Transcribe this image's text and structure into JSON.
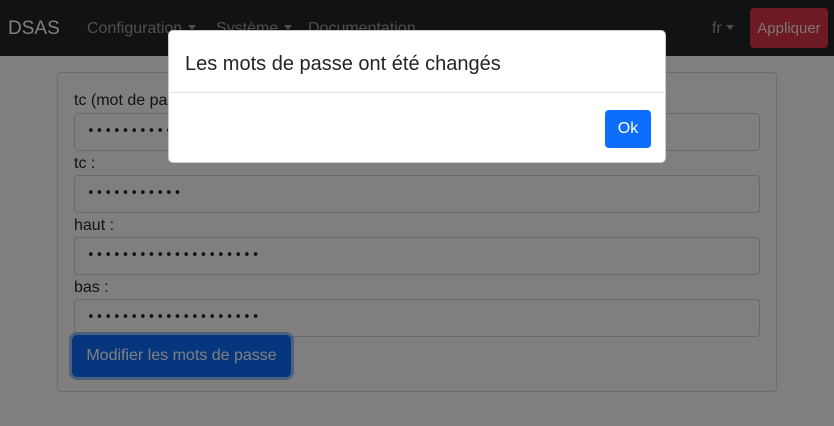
{
  "navbar": {
    "brand": "DSAS",
    "menu": [
      {
        "label": "Configuration",
        "has_dropdown": true
      },
      {
        "label": "Système",
        "has_dropdown": true
      },
      {
        "label": "Documentation",
        "has_dropdown": false
      }
    ],
    "language": "fr",
    "apply_label": "Appliquer",
    "bg_color": "#212529",
    "apply_color": "#dc3545"
  },
  "form": {
    "fields": [
      {
        "label": "tc (mot de passe actuel) :",
        "value": "•••••••••••"
      },
      {
        "label": "tc :",
        "value": "•••••••••••"
      },
      {
        "label": "haut :",
        "value": "••••••••••••••••••••"
      },
      {
        "label": "bas :",
        "value": "••••••••••••••••••••"
      }
    ],
    "submit_label": "Modifier les mots de passe",
    "primary_color": "#0d6efd"
  },
  "modal": {
    "message": "Les mots de passe ont été changés",
    "ok_label": "Ok"
  }
}
